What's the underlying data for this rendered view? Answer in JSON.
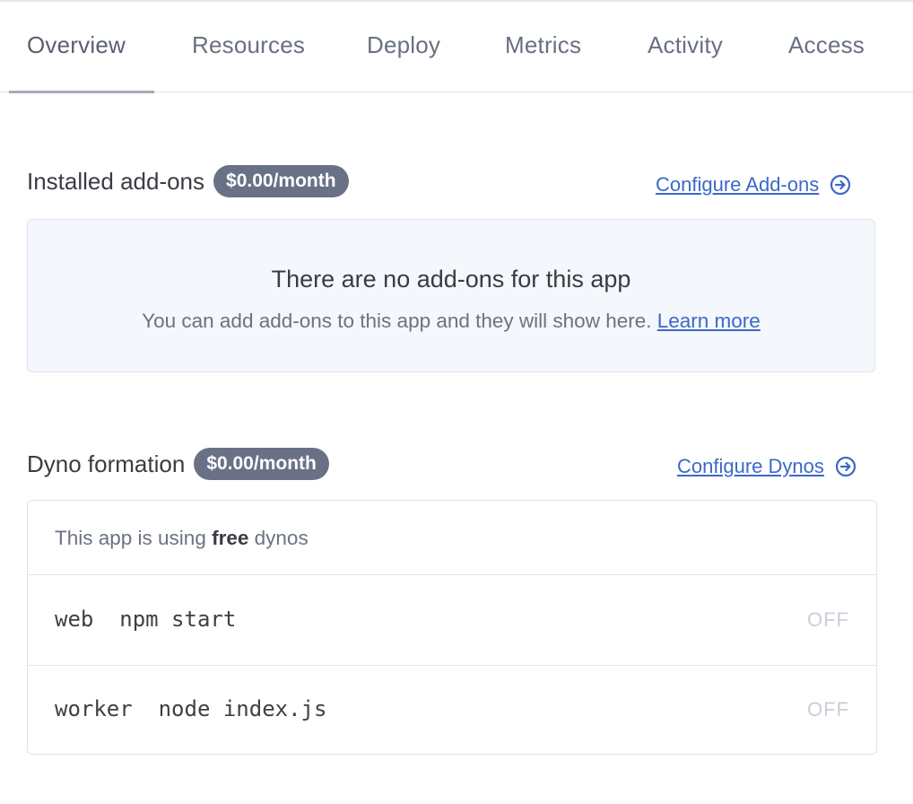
{
  "tabs": [
    {
      "label": "Overview",
      "active": true
    },
    {
      "label": "Resources",
      "active": false
    },
    {
      "label": "Deploy",
      "active": false
    },
    {
      "label": "Metrics",
      "active": false
    },
    {
      "label": "Activity",
      "active": false
    },
    {
      "label": "Access",
      "active": false
    }
  ],
  "addons": {
    "title": "Installed add-ons",
    "cost": "$0.00/month",
    "configure_label": "Configure Add-ons",
    "empty_title": "There are no add-ons for this app",
    "empty_text": "You can add add-ons to this app and they will show here.",
    "learn_more": "Learn more"
  },
  "dynos": {
    "title": "Dyno formation",
    "cost": "$0.00/month",
    "configure_label": "Configure Dynos",
    "info_prefix": "This app is using",
    "info_bold": "free",
    "info_suffix": "dynos",
    "processes": [
      {
        "command": "web  npm start",
        "state": "OFF"
      },
      {
        "command": "worker  node index.js",
        "state": "OFF"
      }
    ]
  },
  "colors": {
    "link": "#3d68c9",
    "badge": "#6a7186",
    "empty_bg": "#f4f7fb"
  },
  "icons": {
    "configure_arrow": "arrow-circle-right-icon"
  }
}
